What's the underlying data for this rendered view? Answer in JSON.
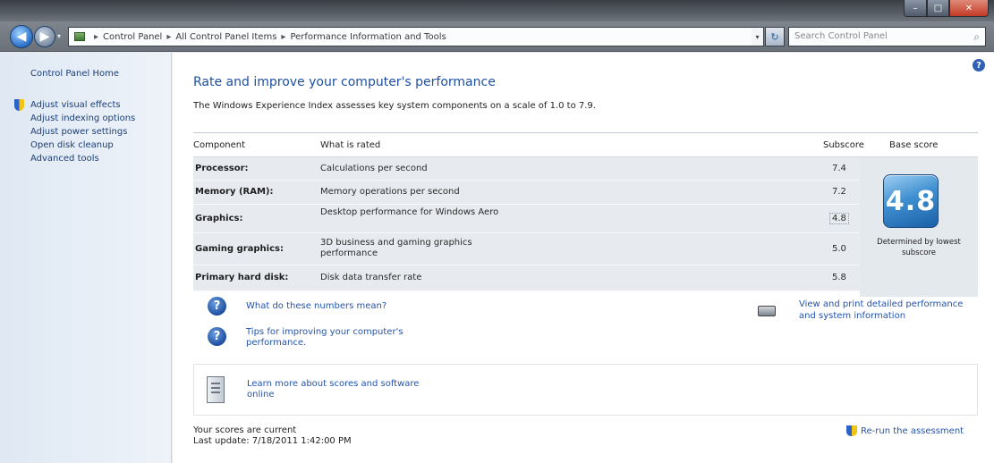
{
  "window": {
    "controls": {
      "minimize": "–",
      "maximize": "□",
      "close": "✕"
    }
  },
  "nav": {
    "back_glyph": "◀",
    "forward_glyph": "▶",
    "history_glyph": "▾",
    "breadcrumbs": [
      "Control Panel",
      "All Control Panel Items",
      "Performance Information and Tools"
    ],
    "separator": "▸",
    "dropdown_glyph": "▾",
    "refresh_glyph": "↻",
    "search_placeholder": "Search Control Panel",
    "search_glyph": "⌕"
  },
  "sidebar": {
    "home": "Control Panel Home",
    "links": [
      "Adjust visual effects",
      "Adjust indexing options",
      "Adjust power settings",
      "Open disk cleanup",
      "Advanced tools"
    ]
  },
  "main": {
    "help_glyph": "?",
    "title": "Rate and improve your computer's performance",
    "description": "The Windows Experience Index assesses key system components on a scale of 1.0 to 7.9.",
    "table": {
      "headers": {
        "component": "Component",
        "rated": "What is rated",
        "subscore": "Subscore",
        "base": "Base score"
      },
      "rows": [
        {
          "component": "Processor:",
          "rated": "Calculations per second",
          "subscore": "7.4"
        },
        {
          "component": "Memory (RAM):",
          "rated": "Memory operations per second",
          "subscore": "7.2"
        },
        {
          "component": "Graphics:",
          "rated": "Desktop performance for Windows Aero",
          "subscore": "4.8"
        },
        {
          "component": "Gaming graphics:",
          "rated": "3D business and gaming graphics performance",
          "subscore": "5.0"
        },
        {
          "component": "Primary hard disk:",
          "rated": "Disk data transfer rate",
          "subscore": "5.8"
        }
      ],
      "base_score": "4.8",
      "base_note": "Determined by lowest subscore"
    },
    "links": {
      "what_mean": "What do these numbers mean?",
      "tips": "Tips for improving your computer's performance.",
      "view_print": "View and print detailed performance and system information",
      "learn": "Learn more about scores and software online"
    },
    "question_glyph": "?",
    "status_line1": "Your scores are current",
    "status_line2": "Last update: 7/18/2011 1:42:00 PM",
    "rerun": "Re-run the assessment"
  }
}
